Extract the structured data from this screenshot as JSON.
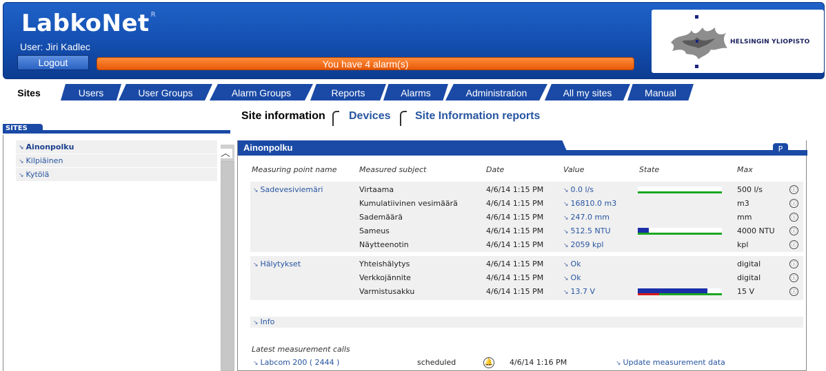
{
  "header": {
    "app_title": "LabkoNet",
    "trademark": "R",
    "user_label": "User: Jiri Kadlec",
    "logout_label": "Logout",
    "alarm_message": "You have 4 alarm(s)",
    "logo_text": "HELSINGIN YLIOPISTO"
  },
  "main_tabs": [
    {
      "label": "Sites",
      "active": true
    },
    {
      "label": "Users"
    },
    {
      "label": "User Groups"
    },
    {
      "label": "Alarm Groups"
    },
    {
      "label": "Reports"
    },
    {
      "label": "Alarms"
    },
    {
      "label": "Administration"
    },
    {
      "label": "All my sites"
    },
    {
      "label": "Manual"
    }
  ],
  "sub_tabs": [
    {
      "label": "Site information",
      "active": true
    },
    {
      "label": "Devices"
    },
    {
      "label": "Site Information reports"
    }
  ],
  "sidebar": {
    "title": "SITES",
    "items": [
      {
        "label": "Ainonpolku",
        "active": true
      },
      {
        "label": "Kilpiäinen"
      },
      {
        "label": "Kytölä"
      }
    ]
  },
  "panel": {
    "title": "Ainonpolku",
    "p_button": "P",
    "columns": [
      "Measuring point name",
      "Measured subject",
      "Date",
      "Value",
      "State",
      "Max"
    ],
    "groups": [
      {
        "point": "Sadevesiviemäri",
        "rows": [
          {
            "subject": "Virtaama",
            "date": "4/6/14 1:15 PM",
            "value": "0.0 l/s",
            "max": "500  l/s",
            "state": {
              "blue": 0.0,
              "line": "green"
            }
          },
          {
            "subject": "Kumulatiivinen vesimäärä",
            "date": "4/6/14 1:15 PM",
            "value": "16810.0 m3",
            "max": "m3"
          },
          {
            "subject": "Sademäärä",
            "date": "4/6/14 1:15 PM",
            "value": "247.0 mm",
            "max": "mm"
          },
          {
            "subject": "Sameus",
            "date": "4/6/14 1:15 PM",
            "value": "512.5 NTU",
            "max": "4000  NTU",
            "state": {
              "blue": 0.13,
              "line": "green"
            }
          },
          {
            "subject": "Näytteenotin",
            "date": "4/6/14 1:15 PM",
            "value": "2059 kpl",
            "max": "kpl"
          }
        ]
      },
      {
        "point": "Hälytykset",
        "rows": [
          {
            "subject": "Yhteishälytys",
            "date": "4/6/14 1:15 PM",
            "value": "Ok",
            "max": "digital"
          },
          {
            "subject": "Verkkojännite",
            "date": "4/6/14 1:15 PM",
            "value": "Ok",
            "max": "digital"
          },
          {
            "subject": "Varmistusakku",
            "date": "4/6/14 1:15 PM",
            "value": "13.7 V",
            "max": "15  V",
            "state": {
              "blue": 0.83,
              "line": "red-green",
              "red": 0.25
            }
          }
        ]
      }
    ],
    "info_label": "Info",
    "info_icon": "info-icon",
    "latest_label": "Latest measurement calls",
    "calls": [
      {
        "device": "Labcom 200 ( 2444 )",
        "status": "scheduled",
        "time": "4/6/14 1:16 PM",
        "action": "Update measurement data"
      }
    ]
  },
  "colors": {
    "header_blue": "#1652b4",
    "tab_blue": "#1a4aa6",
    "alarm_orange": "#f07020",
    "link_blue": "#2654a0",
    "state_blue": "#1a2ea8",
    "state_green": "#1aa620",
    "state_red": "#d81818"
  }
}
